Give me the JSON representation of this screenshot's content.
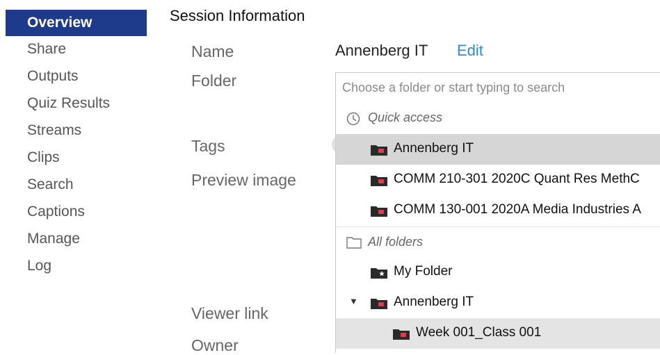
{
  "sidebar": {
    "items": [
      {
        "label": "Overview",
        "active": true
      },
      {
        "label": "Share"
      },
      {
        "label": "Outputs"
      },
      {
        "label": "Quiz Results"
      },
      {
        "label": "Streams"
      },
      {
        "label": "Clips"
      },
      {
        "label": "Search"
      },
      {
        "label": "Captions"
      },
      {
        "label": "Manage"
      },
      {
        "label": "Log"
      }
    ]
  },
  "main": {
    "title": "Session Information",
    "labels": {
      "name": "Name",
      "folder": "Folder",
      "tags": "Tags",
      "preview_image": "Preview image",
      "viewer_link": "Viewer link",
      "owner": "Owner"
    },
    "session_name": "Annenberg IT",
    "edit_label": "Edit"
  },
  "folder_picker": {
    "placeholder": "Choose a folder or start typing to search",
    "quick_access": {
      "header": "Quick access",
      "icon": "clock-icon",
      "items": [
        {
          "label": "Annenberg IT",
          "selected": true,
          "icon": "recording-folder-icon"
        },
        {
          "label": "COMM 210-301 2020C Quant Res MethC",
          "icon": "recording-folder-icon"
        },
        {
          "label": "COMM 130-001 2020A Media Industries A",
          "icon": "recording-folder-icon"
        }
      ]
    },
    "all_folders": {
      "header": "All folders",
      "icon": "folder-outline-icon",
      "items": [
        {
          "label": "My Folder",
          "icon": "star-folder-icon"
        },
        {
          "label": "Annenberg IT",
          "expanded": true,
          "icon": "recording-folder-icon"
        },
        {
          "label": "Week 001_Class 001",
          "icon": "recording-folder-icon"
        }
      ]
    }
  },
  "colors": {
    "accent": "#1e3a8a",
    "link": "#2b8ad6",
    "selected_row": "#d6d6d6",
    "folder_badge": "#e8384a"
  }
}
